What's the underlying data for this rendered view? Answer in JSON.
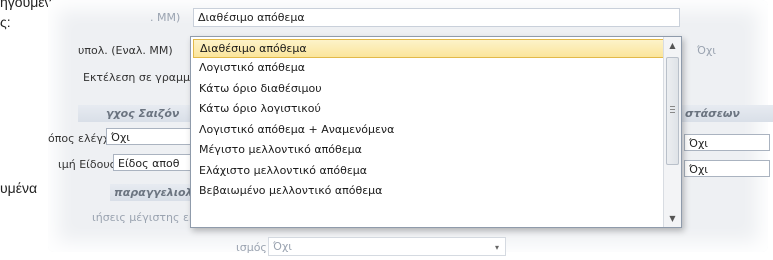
{
  "doc": {
    "line1": "ηγούμενες",
    "line2": "ς:",
    "line3": "υμένα"
  },
  "form": {
    "row1_label": ". ΜΜ)",
    "row1_value": "Διαθέσιμο απόθεμα",
    "row2_label": "υπολ. (Εναλ. ΜΜ)",
    "row3_label": "Εκτέλεση σε γραμμές",
    "section1": "γχος Σαιζόν",
    "section1_right": "στάσεων",
    "ctrl_method_label": "όπος ελέγχου",
    "ctrl_method_value": "Όχι",
    "item_value_label": "ιμή Είδους",
    "item_value_value": "Είδος αποθ",
    "section2": "παραγγελιοληψία",
    "max_exec_label": "ιήσεις μέγιστης εκτ",
    "bottom_label": "ισμός",
    "bottom_value": "Όχι",
    "right_combo1": "Όχι",
    "right_combo2": "Όχι",
    "right_faded": "Όχι"
  },
  "dropdown": {
    "options": [
      "Διαθέσιμο απόθεμα",
      "Λογιστικό απόθεμα",
      "Κάτω όριο διαθέσιμου",
      "Κάτω όριο λογιστικού",
      "Λογιστικό απόθεμα + Αναμενόμενα",
      "Μέγιστο μελλοντικό απόθεμα",
      "Ελάχιστο μελλοντικό απόθεμα",
      "Βεβαιωμένο μελλοντικό απόθεμα"
    ]
  }
}
